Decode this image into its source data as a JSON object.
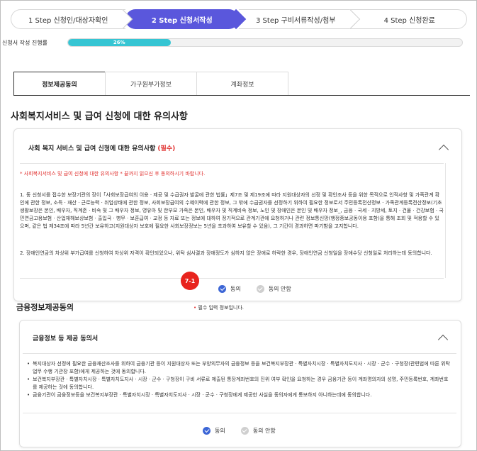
{
  "steps": [
    {
      "label": "1 Step 신청인/대상자확인",
      "active": false
    },
    {
      "label": "2 Step 신청서작성",
      "active": true
    },
    {
      "label": "3 Step 구비서류작성/첨부",
      "active": false
    },
    {
      "label": "4 Step 신청완료",
      "active": false
    }
  ],
  "progress": {
    "label": "신청서 작성 진행률",
    "percent_text": "26%",
    "value": 26
  },
  "tabs": [
    {
      "label": "정보제공동의",
      "active": true
    },
    {
      "label": "가구원부가정보",
      "active": false
    },
    {
      "label": "계좌정보",
      "active": false
    }
  ],
  "section_title": "사회복지서비스 및 급여 신청에 대한 유의사항",
  "card1": {
    "title": "사회 복지 서비스 및 급여 신청에 대한 유의사항",
    "required": "(필수)",
    "notice": "* 사회복지서비스 및 급여 신청에 대한 유의사항 * 끝까지 읽으신 후 동의하시기 바랍니다.",
    "paragraph1": "1. 동 신청서를 접수한 보장기관의 장이「사회보장급여의 이용 · 제공 및 수급권자 발굴에 관한 법률」제7조 및 제19조에 따라 지원대상자의 선정 및 확인조사 등을 위한 목적으로 인적사항 및 가족관계 확인에 관한 정보, 소득 · 재산 · 근로능력 · 취업상태에 관한 정보, 사회보장급여의 수혜이력에 관한 정보, 그 밖에 수급권자를 선정하기 위하여 필요한 정보로서 주민등록전산정보 · 가족관계등록전산정보(기초생활보장은 본인, 배우자, 직계존 · 비속 및 그 배우자 정보, 영유아 및 한부모 가족은 본인, 배우자 및 직계비속 정보, 노인 및 장애인은 본인 및 배우자 정보_, 금융 · 국세 · 지방세, 토지 · 건물 · 건강보험 · 국민연금고용보험 · 산업재해보상보험 · 출입국 · 병무 · 보훈급여 · 교정 등 자료 또는 정보에 대하여 정기적으로 관계기관에 요청하거나 관련 정보통신망(행정중보공동이용 포함)을 통해 조회 및 적용할 수 있으며, 같은 법 제34조에 따라 5년간 보유하고(지원대상자 보호에 필요한 사회보장정보는 5년을 초과하여 보유할 수 있음), 그 기간이 경과하면 파기함을 고지합니다.",
    "paragraph2": "2. 장애인연금의 차상위 부가급여를 신청하여 차상위 자격이 확인되었으나, 위탁 심사결과 장애정도가 심하지 않은 장애로 하락한 경우, 장애인연금 신청일을 장애수당 신청일로 처리하는데 동의합니다.",
    "agree": "동의",
    "disagree": "동의 안함"
  },
  "marker": "7-1",
  "financial": {
    "title": "금융정보제공동의",
    "required_note_dot": "•",
    "required_note": "필수 입력 정보입니다.",
    "card_title": "금융정보 등 제공 동의서",
    "bullets": [
      "복지대상자 선정에 필요한 금융재산조사를 위하여 금융기관 등이 지원대상자 또는 부양의무자의 금융정보 등을 보건복지부장관 · 특별자치시장 · 특별자치도지사 · 시장 · 군수 · 구청장(관련법에 따른 위탁업무 수행 기관장 포함)에게 제공하는 것에 동의합니다.",
      "보건복지부장관 · 특별자치시장 · 특별자치도지사 · 시장 · 군수 · 구청장이 구비 서류로 제출된 통장계좌번호의 진위 여부 확인을 요청하는 경우 금융기관 등이 계좌명의자의 성명, 주민등록번호, 계좌번호를 제공하는 것에 동의합니다.",
      "금융기관이 금융정보등을 보건복지부장관 · 특별자치시장 · 특별자치도지사 · 시장 · 군수 · 구청장에게 제공한 사실을 동의자에게 통보하지 아니하는데에 동의합니다."
    ],
    "agree": "동의",
    "disagree": "동의 안함"
  }
}
